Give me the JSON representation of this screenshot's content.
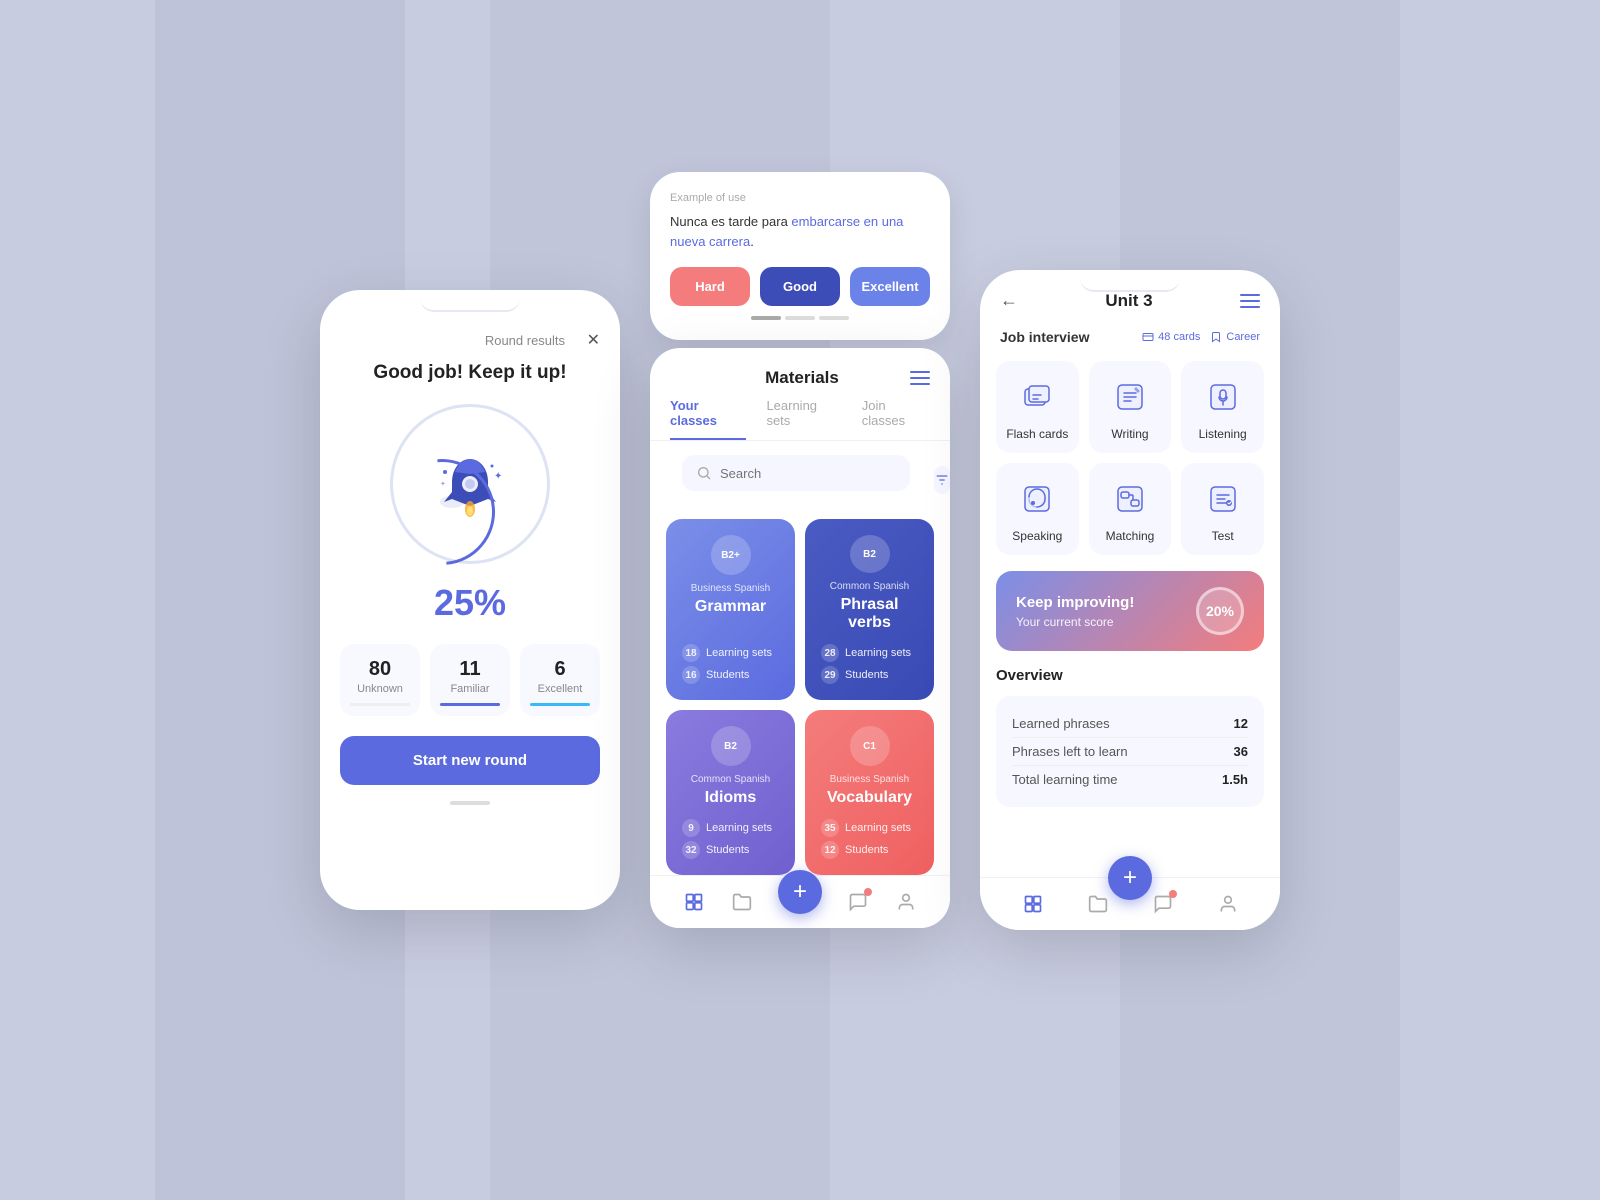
{
  "background": "#c8cce0",
  "phone1": {
    "header_label": "Round results",
    "main_title": "Good job! Keep it up!",
    "percent": "25%",
    "stats": [
      {
        "num": "80",
        "label": "Unknown",
        "bar": "none"
      },
      {
        "num": "11",
        "label": "Familiar",
        "bar": "purple"
      },
      {
        "num": "6",
        "label": "Excellent",
        "bar": "blue"
      }
    ],
    "start_btn": "Start new round"
  },
  "phone2_top": {
    "example_label": "Example of use",
    "sentence": "Nunca es tarde para embarcarse en una nueva carrera.",
    "link_text": "embarcarse en una nueva carrera",
    "hard": "Hard",
    "good": "Good",
    "excellent": "Excellent"
  },
  "phone2_main": {
    "title": "Materials",
    "tabs": [
      "Your classes",
      "Learning sets",
      "Join classes"
    ],
    "active_tab": 0,
    "search_placeholder": "Search",
    "cards": [
      {
        "badge": "B2+",
        "subtitle": "Business Spanish",
        "name": "Grammar",
        "learning_sets": "18",
        "students": "16",
        "color": "blue"
      },
      {
        "badge": "B2",
        "subtitle": "Common Spanish",
        "name": "Phrasal verbs",
        "learning_sets": "28",
        "students": "29",
        "color": "dark-blue"
      },
      {
        "badge": "B2",
        "subtitle": "Common Spanish",
        "name": "Idioms",
        "learning_sets": "9",
        "students": "32",
        "color": "purple"
      },
      {
        "badge": "C1",
        "subtitle": "Business Spanish",
        "name": "Vocabulary",
        "learning_sets": "35",
        "students": "12",
        "color": "coral"
      }
    ],
    "learning_sets_label": "Learning sets",
    "students_label": "Students"
  },
  "phone3": {
    "nav_title": "Unit 3",
    "job_title": "Job interview",
    "cards_count": "48 cards",
    "tag": "Career",
    "activities": [
      {
        "icon": "cards",
        "label": "Flash cards"
      },
      {
        "icon": "write",
        "label": "Writing"
      },
      {
        "icon": "listen",
        "label": "Listening"
      },
      {
        "icon": "speak",
        "label": "Speaking"
      },
      {
        "icon": "match",
        "label": "Matching"
      },
      {
        "icon": "test",
        "label": "Test"
      }
    ],
    "banner_title": "Keep improving!",
    "banner_subtitle": "Your current score",
    "banner_percent": "20%",
    "overview_title": "Overview",
    "overview_rows": [
      {
        "key": "Learned phrases",
        "val": "12"
      },
      {
        "key": "Phrases left to learn",
        "val": "36"
      },
      {
        "key": "Total learning time",
        "val": "1.5h"
      }
    ]
  }
}
